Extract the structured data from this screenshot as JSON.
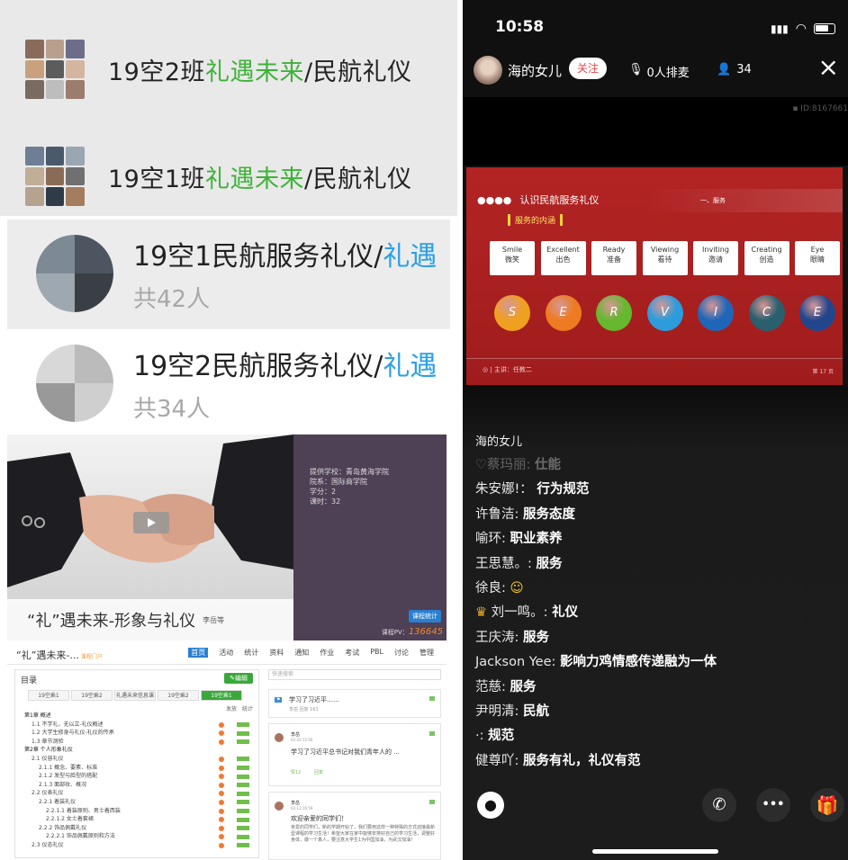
{
  "groups": [
    {
      "prefix": "19空2班",
      "highlight": "礼遇未来",
      "suffix": "/民航礼仪"
    },
    {
      "prefix": "19空1班",
      "highlight": "礼遇未来",
      "suffix": "/民航礼仪"
    }
  ],
  "groups2": [
    {
      "prefix": "19空1民航服务礼仪/",
      "highlight": "礼遇",
      "count": "共42人"
    },
    {
      "prefix": "19空2民航服务礼仪/",
      "highlight": "礼遇",
      "count": "共34人"
    }
  ],
  "course": {
    "info": [
      "提供学校：青岛黄海学院",
      "院系：国际商学院",
      "学分：2",
      "课时：32"
    ],
    "title": "“礼”遇未来-形象与礼仪",
    "teacher": "李岳等",
    "badge": "课程统计",
    "pv_label": "课程PV：",
    "pv_value": "136645"
  },
  "lms": {
    "title": "“礼”遇未来-...",
    "title_sub": "课程门户",
    "nav": [
      "首页",
      "活动",
      "统计",
      "资料",
      "通知",
      "作业",
      "考试",
      "PBL",
      "讨论",
      "管理"
    ],
    "toc_label": "目录",
    "edit_label": "编辑",
    "class_tabs": [
      "19空乘1",
      "19空乘2",
      "礼遇未来信息课",
      "19空乘2",
      "19空乘1"
    ],
    "col_labels": [
      "发放",
      "统计"
    ],
    "chapters": [
      {
        "text": "第1章 概述",
        "lvl": 0
      },
      {
        "text": "1.1 不学礼，无以立-礼仪概述",
        "lvl": 1
      },
      {
        "text": "1.2 大学生修身与礼仪-礼仪的传承",
        "lvl": 1
      },
      {
        "text": "1.3 章节测验",
        "lvl": 1
      },
      {
        "text": "第2章 个人形象礼仪",
        "lvl": 0
      },
      {
        "text": "2.1 仪容礼仪",
        "lvl": 1
      },
      {
        "text": "2.1.1 概念、要素、标准",
        "lvl": 2
      },
      {
        "text": "2.1.2 发型与脸型的搭配",
        "lvl": 2
      },
      {
        "text": "2.1.3 面部妆、概况",
        "lvl": 2
      },
      {
        "text": "2.2 仪表礼仪",
        "lvl": 1
      },
      {
        "text": "2.2.1 着装礼仪",
        "lvl": 2
      },
      {
        "text": "2.2.1.1 着装原则、男士着西装",
        "lvl": 3
      },
      {
        "text": "2.2.1.2 女士着套裙",
        "lvl": 3
      },
      {
        "text": "2.2.2 饰品佩戴礼仪",
        "lvl": 2
      },
      {
        "text": "2.2.2.1 饰品佩戴原则和方法",
        "lvl": 3
      },
      {
        "text": "2.3 仪态礼仪",
        "lvl": 1
      }
    ],
    "search_placeholder": "快速搜索",
    "feed": [
      {
        "title": "学习了习近平……",
        "meta": "李岳   回复 161"
      },
      {
        "author": "李岳",
        "date": "02-20 15:00",
        "text": "学习了习近平总书记对我们青年人的 ...",
        "likes": "赞12",
        "reply": "回复"
      },
      {
        "author": "李岳",
        "date": "02-13 16:59",
        "text": "欢迎亲爱的同学们！",
        "body": "亲爱的同学们，新的学期开始了，我们要用这样一种特殊的方式迎接最新型课程的学习生活！希望大家在家中能够安排好自己的学习生活，调整好身体，做一个真人，要注意大学生1为中国加油，为武汉加油！"
      }
    ]
  },
  "phone": {
    "time": "10:58",
    "host": "海的女儿",
    "follow": "关注",
    "queue": "0人排麦",
    "viewers": "34",
    "room_id": "ID:8167661",
    "ppt": {
      "header": "认识民航服务礼仪",
      "section": "一、服务",
      "sub": "服务的内涵",
      "cards": [
        {
          "en": "Smile",
          "cn": "微笑",
          "letter": "S",
          "color": "#f0a020"
        },
        {
          "en": "Excellent",
          "cn": "出色",
          "letter": "E",
          "color": "#ee7b22"
        },
        {
          "en": "Ready",
          "cn": "准备",
          "letter": "R",
          "color": "#66b82e"
        },
        {
          "en": "Viewing",
          "cn": "看待",
          "letter": "V",
          "color": "#2c9cdc"
        },
        {
          "en": "Inviting",
          "cn": "邀请",
          "letter": "I",
          "color": "#1f66b8"
        },
        {
          "en": "Creating",
          "cn": "创造",
          "letter": "C",
          "color": "#2a5f6e"
        },
        {
          "en": "Eye",
          "cn": "眼睛",
          "letter": "E",
          "color": "#22468c"
        }
      ],
      "footer_left": "主讲：任教二",
      "page": "第 17 页"
    },
    "chat_header": "海的女儿",
    "chat": [
      {
        "user": "♡蔡玛丽:",
        "msg": "仕能",
        "faded": true
      },
      {
        "user": "朱安娜!：",
        "msg": "行为规范"
      },
      {
        "user": "许鲁洁:",
        "msg": "服务态度"
      },
      {
        "user": "喻环:",
        "msg": "职业素养"
      },
      {
        "user": "王思慧。:",
        "msg": "服务"
      },
      {
        "user": "徐良:",
        "msg": "☺"
      },
      {
        "user": "刘一鸣。:",
        "msg": "礼仪",
        "badge": true
      },
      {
        "user": "王庆涛:",
        "msg": "服务"
      },
      {
        "user": "Jackson Yee:",
        "msg": "影响力鸡情感传递融为一体"
      },
      {
        "user": "范慈:",
        "msg": "服务"
      },
      {
        "user": "尹明清:",
        "msg": "民航"
      },
      {
        "user": "·:",
        "msg": "规范"
      },
      {
        "user": "健尊吖:",
        "msg": "服务有礼，礼仪有范"
      }
    ],
    "close": "×",
    "more": "•••"
  }
}
